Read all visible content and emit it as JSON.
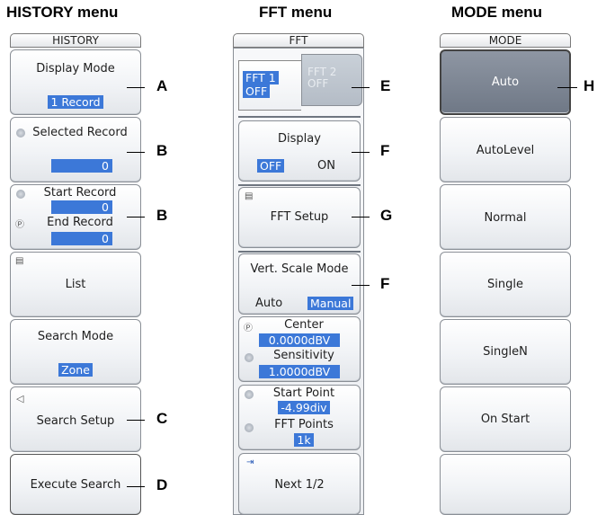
{
  "history": {
    "heading": "HISTORY menu",
    "title": "HISTORY",
    "display_mode_label": "Display Mode",
    "display_mode_value": "1 Record",
    "selected_record_label": "Selected Record",
    "selected_record_value": "0",
    "start_record_label": "Start Record",
    "start_record_value": "0",
    "end_record_label": "End Record",
    "end_record_value": "0",
    "list_label": "List",
    "search_mode_label": "Search Mode",
    "search_mode_value": "Zone",
    "search_setup_label": "Search Setup",
    "execute_search_label": "Execute Search"
  },
  "fft": {
    "heading": "FFT menu",
    "title": "FFT",
    "tab1_line1": "FFT 1",
    "tab1_line2": "OFF",
    "tab2_line1": "FFT 2",
    "tab2_line2": "OFF",
    "display_label": "Display",
    "display_off": "OFF",
    "display_on": "ON",
    "fft_setup_label": "FFT Setup",
    "vert_scale_label": "Vert. Scale Mode",
    "vert_auto": "Auto",
    "vert_manual": "Manual",
    "center_label": "Center",
    "center_value": "0.0000dBV",
    "sensitivity_label": "Sensitivity",
    "sensitivity_value": "1.0000dBV",
    "start_point_label": "Start Point",
    "start_point_value": "-4.99div",
    "fft_points_label": "FFT Points",
    "fft_points_value": "1k",
    "next_label": "Next 1/2"
  },
  "mode": {
    "heading": "MODE menu",
    "title": "MODE",
    "items": [
      "Auto",
      "AutoLevel",
      "Normal",
      "Single",
      "SingleN",
      "On Start",
      ""
    ]
  },
  "callouts": {
    "a": "A",
    "b1": "B",
    "b2": "B",
    "c": "C",
    "d": "D",
    "e": "E",
    "f1": "F",
    "f2": "F",
    "g": "G",
    "h": "H"
  }
}
